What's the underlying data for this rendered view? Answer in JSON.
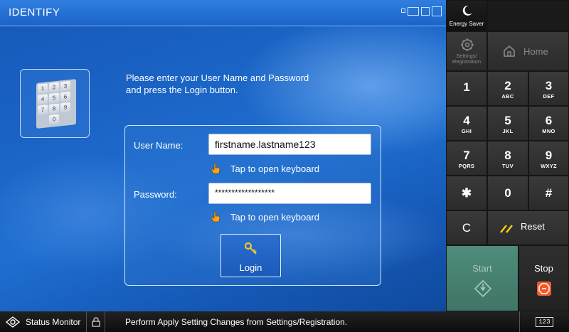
{
  "window": {
    "title": "IDENTIFY"
  },
  "keypad_illustration": {
    "keys": [
      "1",
      "2",
      "3",
      "4",
      "5",
      "6",
      "7",
      "8",
      "9",
      "0"
    ]
  },
  "instruction": "Please enter your User Name and Password\nand press the Login button.",
  "login_form": {
    "username_label": "User Name:",
    "username_value": "firstname.lastname123",
    "password_label": "Password:",
    "password_value": "******************",
    "keyboard_hint": "Tap to open keyboard",
    "login_label": "Login"
  },
  "status_bar": {
    "status_monitor_label": "Status Monitor",
    "message": "Perform Apply Setting Changes from Settings/Registration.",
    "counter_label": "123"
  },
  "control_panel": {
    "energy_saver_label": "Energy Saver",
    "settings_label": "Settings/\nRegistration",
    "home_label": "Home",
    "keys": [
      {
        "num": "1",
        "sub": ""
      },
      {
        "num": "2",
        "sub": "ABC"
      },
      {
        "num": "3",
        "sub": "DEF"
      },
      {
        "num": "4",
        "sub": "GHI"
      },
      {
        "num": "5",
        "sub": "JKL"
      },
      {
        "num": "6",
        "sub": "MNO"
      },
      {
        "num": "7",
        "sub": "PQRS"
      },
      {
        "num": "8",
        "sub": "TUV"
      },
      {
        "num": "9",
        "sub": "WXYZ"
      },
      {
        "num": "✱",
        "sub": ""
      },
      {
        "num": "0",
        "sub": ""
      },
      {
        "num": "#",
        "sub": ""
      }
    ],
    "clear_label": "C",
    "reset_label": "Reset",
    "start_label": "Start",
    "stop_label": "Stop"
  },
  "colors": {
    "title_bar": "#1c63c7",
    "start_button": "#4f8c7b",
    "stop_icon": "#f05a28",
    "reset_icon": "#f2d21b",
    "key_icon": "#f2c230"
  }
}
